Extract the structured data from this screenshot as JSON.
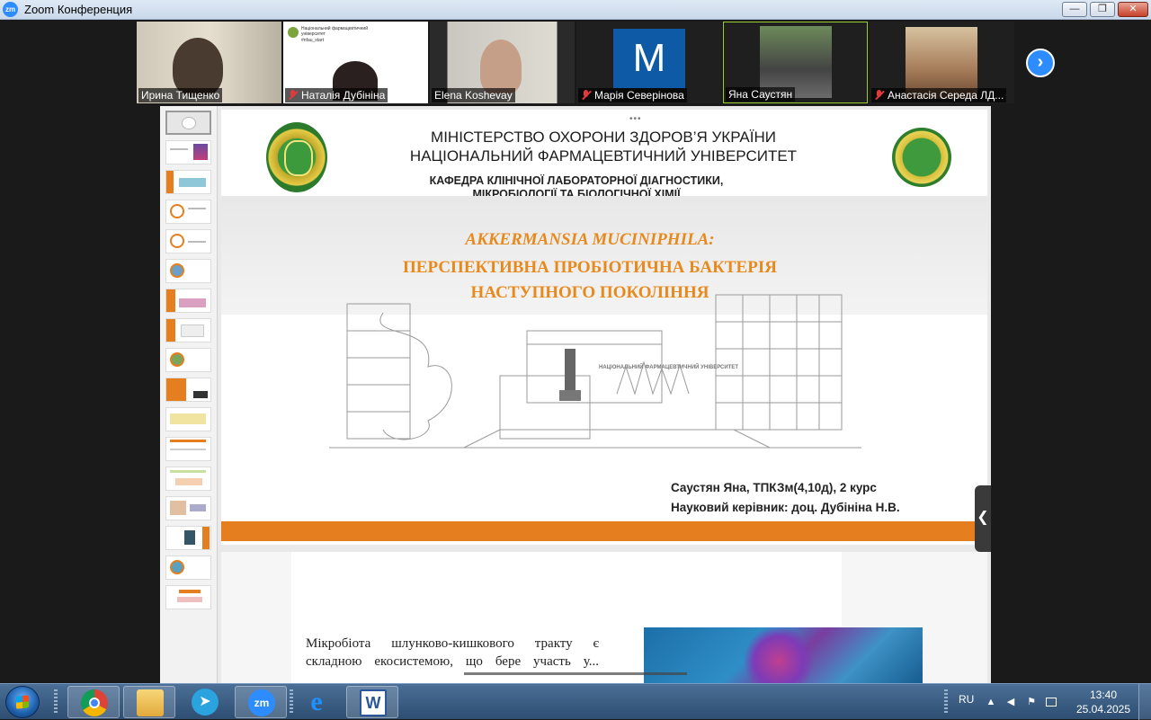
{
  "window": {
    "title": "Zoom Конференция",
    "logo_text": "zm",
    "minimize": "—",
    "restore": "❐",
    "close": "✕"
  },
  "participants": [
    {
      "name": "Ирина Тищенко",
      "muted": false
    },
    {
      "name": "Наталія Дубініна",
      "muted": true,
      "share_title": "Національний фармацевтичний університет",
      "share_tag": "#nfau_start"
    },
    {
      "name": "Elena Koshevay",
      "muted": false
    },
    {
      "name": "Марія Северінова",
      "muted": true,
      "avatar_letter": "M"
    },
    {
      "name": "Яна Саустян",
      "muted": false
    },
    {
      "name": "Анастасія Середа ЛД...",
      "muted": true
    }
  ],
  "next_button": "›",
  "slide": {
    "grip": "•••",
    "ministry_line1": "МІНІСТЕРСТВО ОХОРОНИ ЗДОРОВ’Я УКРАЇНИ",
    "ministry_line2": "НАЦІОНАЛЬНИЙ ФАРМАЦЕВТИЧНИЙ УНІВЕРСИТЕТ",
    "dept_line1": "КАФЕДРА КЛІНІЧНОЇ ЛАБОРАТОРНОЇ ДІАГНОСТИКИ,",
    "dept_line2": "МІКРОБІОЛОГІЇ ТА БІОЛОГІЧНОЇ ХІМІЇ",
    "title_italic": "AKKERMANSIA MUCINIPHILA:",
    "title_line2": "ПЕРСПЕКТИВНА ПРОБІОТИЧНА БАКТЕРІЯ",
    "title_line3": "НАСТУПНОГО ПОКОЛІННЯ",
    "building_sign": "НАЦІОНАЛЬНИЙ ФАРМАЦЕВТИЧНИЙ УНІВЕРСИТЕТ",
    "author": "Саустян Яна, ТПКЗм(4,10д), 2 курс",
    "supervisor": "Науковий керівник: доц. Дубініна Н.В."
  },
  "slide2": {
    "text": "Мікробіота шлунково-кишкового тракту є складною екосистемою, що бере участь у..."
  },
  "collapse_button": "❮",
  "taskbar": {
    "language": "RU",
    "time": "13:40",
    "date": "25.04.2025",
    "zoom_label": "zm"
  },
  "colors": {
    "accent_orange": "#e57e1e",
    "title_orange": "#e8891c",
    "zoom_blue": "#2d8cff"
  }
}
